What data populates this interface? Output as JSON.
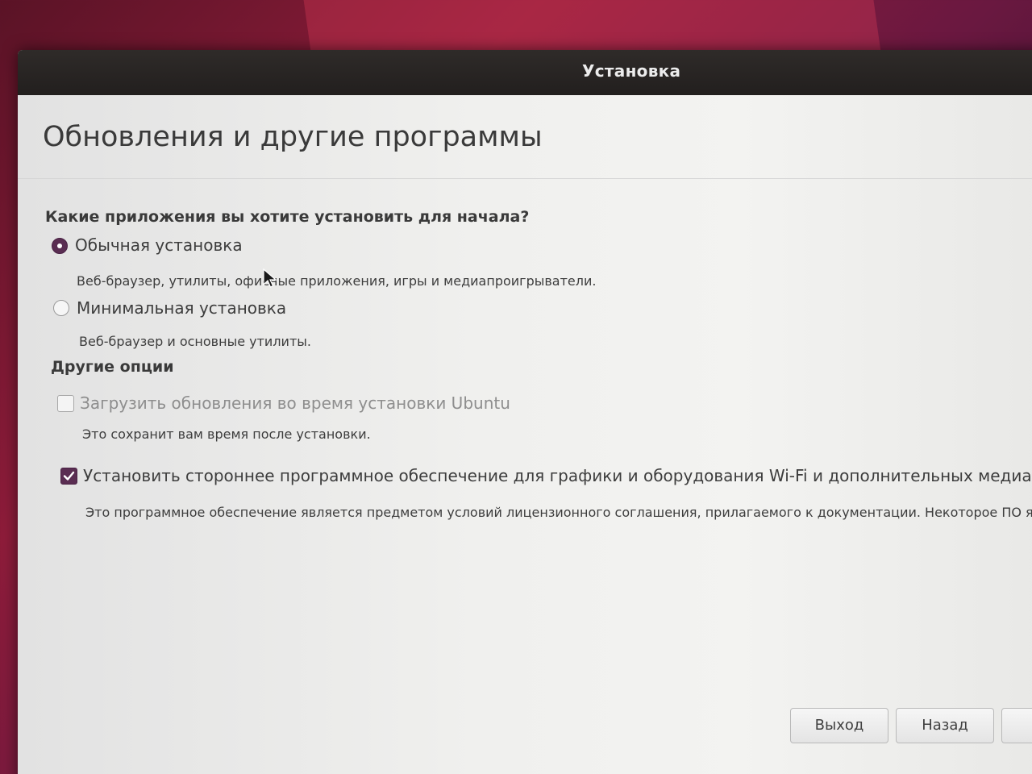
{
  "window": {
    "title": "Установка"
  },
  "page": {
    "heading": "Обновления и другие программы",
    "question": "Какие приложения вы хотите установить для начала?",
    "install_type": {
      "normal": {
        "label": "Обычная установка",
        "description": "Веб-браузер, утилиты, офисные приложения, игры и медиапроигрыватели.",
        "selected": true
      },
      "minimal": {
        "label": "Минимальная установка",
        "description": "Веб-браузер и основные утилиты.",
        "selected": false
      }
    },
    "other_options": {
      "heading": "Другие опции",
      "download_updates": {
        "label": "Загрузить обновления во время установки Ubuntu",
        "description": "Это сохранит вам время после установки.",
        "checked": false,
        "enabled": false
      },
      "third_party": {
        "label": "Установить стороннее программное обеспечение для графики и оборудования Wi-Fi и дополнительных медиа фо",
        "description": "Это программное обеспечение является предметом условий лицензионного соглашения, прилагаемого к документации. Некоторое ПО яв",
        "checked": true,
        "enabled": true
      }
    }
  },
  "buttons": {
    "quit": "Выход",
    "back": "Назад",
    "continue": ""
  },
  "colors": {
    "accent": "#5a2d52",
    "titlebar": "#2a2625",
    "background": "#ececec"
  }
}
